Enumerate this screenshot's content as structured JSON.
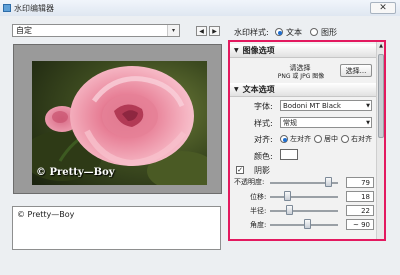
{
  "window": {
    "title": "水印编辑器",
    "close_glyph": "✕"
  },
  "preset": {
    "value": "自定",
    "arrow": "▾"
  },
  "nav": {
    "prev": "◀",
    "next": "▶"
  },
  "preview": {
    "watermark_text": "© Pretty—Boy"
  },
  "text_input": {
    "value": "© Pretty—Boy"
  },
  "watermark_style": {
    "label": "水印样式:",
    "options": [
      "文本",
      "图形"
    ],
    "selected": "文本"
  },
  "image_section": {
    "header": "图像选项",
    "hint_line1": "请选择",
    "hint_line2": "PNG 或 JPG 图像",
    "select_button": "选择..."
  },
  "text_section": {
    "header": "文本选项",
    "font_label": "字体:",
    "font_value": "Bodoni MT Black",
    "style_label": "样式:",
    "style_value": "常规",
    "align_label": "对齐:",
    "align_options": [
      "左对齐",
      "居中",
      "右对齐"
    ],
    "align_selected": "左对齐",
    "color_label": "颜色:",
    "color_value": "#ffffff"
  },
  "shadow": {
    "checkbox_label": "阴影",
    "checked": true,
    "rows": [
      {
        "label": "不透明度:",
        "value": "79"
      },
      {
        "label": "位移:",
        "value": "18"
      },
      {
        "label": "半径:",
        "value": "22"
      },
      {
        "label": "角度:",
        "value": "~ 90"
      }
    ]
  },
  "colors": {
    "highlight": "#e3195f",
    "radio_selected": "#1f6fd1"
  }
}
